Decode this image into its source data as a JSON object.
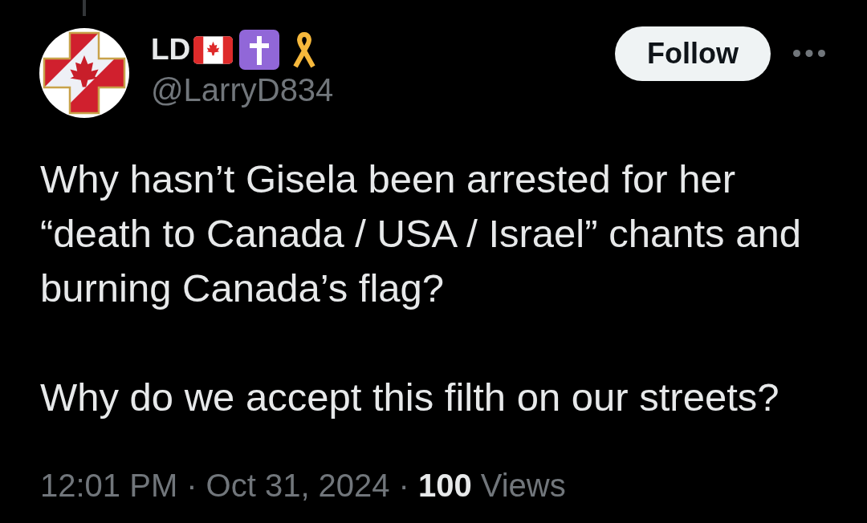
{
  "author": {
    "display_name": "LD",
    "handle": "@LarryD834"
  },
  "follow_button": {
    "label": "Follow"
  },
  "post": {
    "paragraphs": [
      "Why hasn’t Gisela been arrested for her “death to Canada / USA / Israel” chants and burning Canada’s flag?",
      "Why do we accept this filth on our streets?"
    ]
  },
  "meta": {
    "time": "12:01 PM",
    "separator_1": "·",
    "date": "Oct 31, 2024",
    "separator_2": "·",
    "views_count": "100",
    "views_label": "Views"
  }
}
